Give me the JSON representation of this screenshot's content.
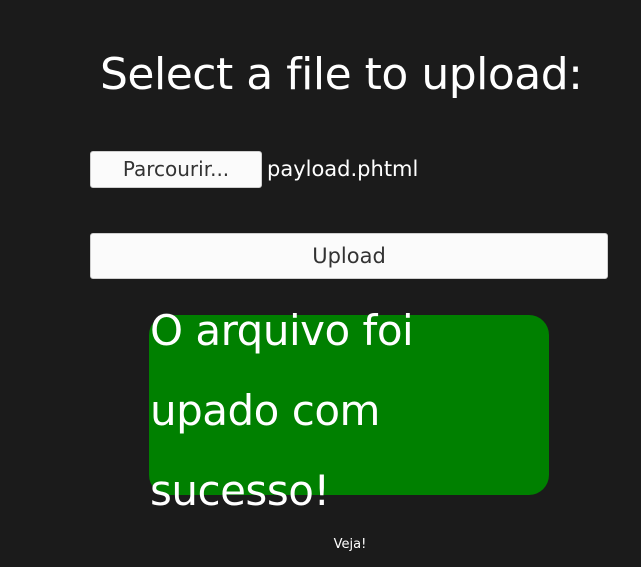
{
  "page": {
    "title": "Select a file to upload:"
  },
  "form": {
    "browse_label": "Parcourir...",
    "selected_file": "payload.phtml",
    "upload_label": "Upload"
  },
  "result": {
    "message": "O arquivo foi upado com sucesso!",
    "link_text": "Veja!"
  },
  "colors": {
    "background": "#1b1b1b",
    "success_box": "#008000",
    "button_bg": "#fbfbfb"
  }
}
